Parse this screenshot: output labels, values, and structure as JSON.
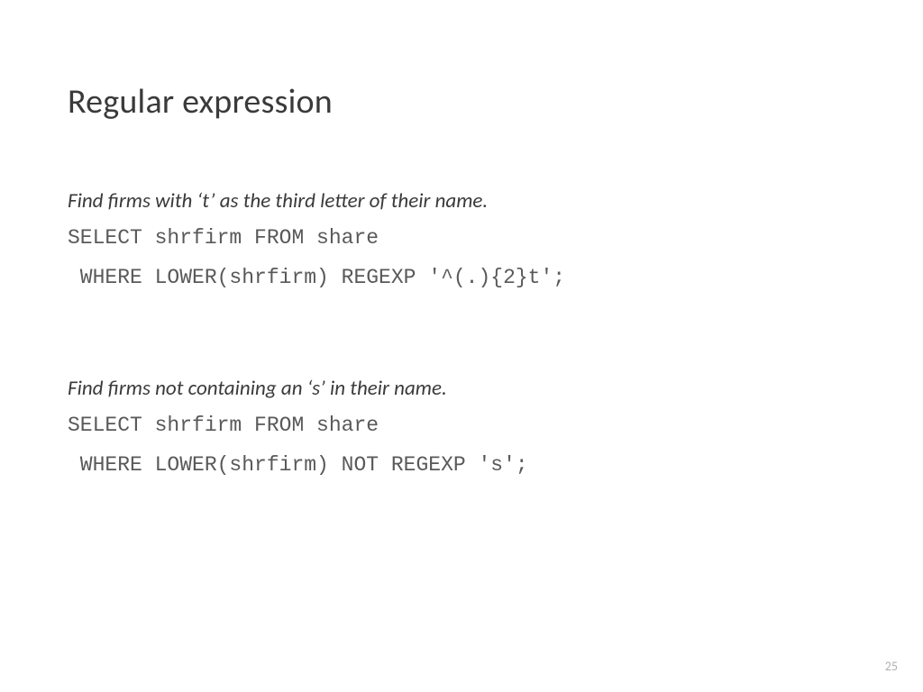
{
  "title": "Regular expression",
  "block1": {
    "desc": "Find firms with ‘t’ as the third letter of their name.",
    "code1": "SELECT shrfirm FROM share",
    "code2": " WHERE LOWER(shrfirm) REGEXP '^(.){2}t';"
  },
  "block2": {
    "desc": "Find firms not containing an ‘s’ in their name.",
    "code1": "SELECT shrfirm FROM share",
    "code2": " WHERE LOWER(shrfirm) NOT REGEXP 's';"
  },
  "pageNumber": "25"
}
